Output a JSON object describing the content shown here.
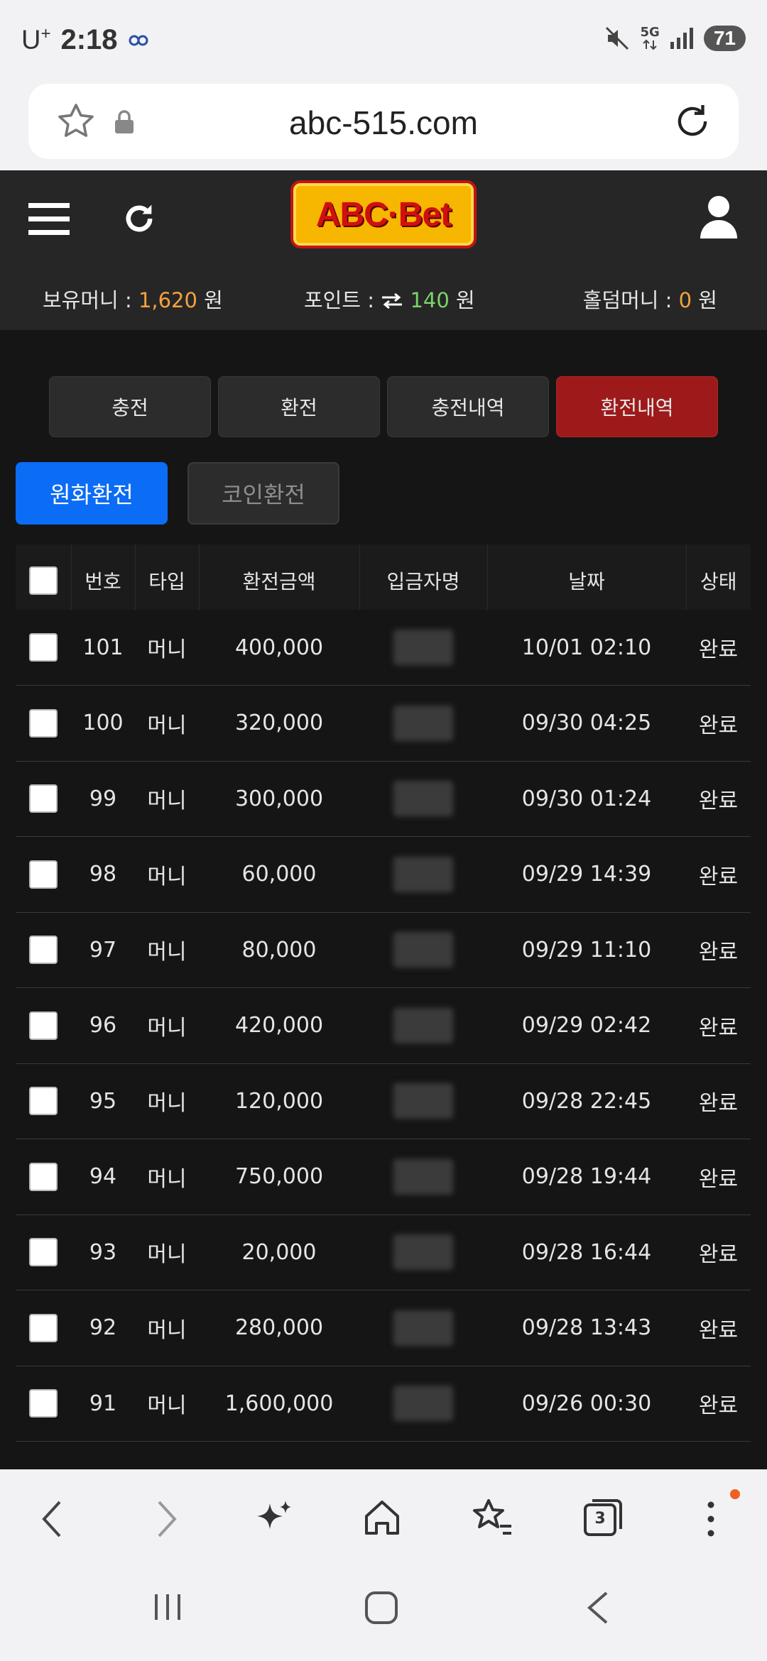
{
  "status_bar": {
    "carrier": "U",
    "carrier_sup": "+",
    "time": "2:18",
    "network": "5G",
    "battery": "71"
  },
  "browser": {
    "url": "abc-515.com",
    "tab_count": "3"
  },
  "site": {
    "logo_text": "ABC·Bet",
    "balances": {
      "money_label": "보유머니 : ",
      "money_value": "1,620",
      "money_unit": " 원",
      "point_label": "포인트 : ",
      "point_value": "140",
      "point_unit": " 원",
      "holdem_label": "홀덤머니 : ",
      "holdem_value": "0",
      "holdem_unit": " 원"
    },
    "tabs": [
      "충전",
      "환전",
      "충전내역",
      "환전내역"
    ],
    "active_tab": "환전내역",
    "subtabs": [
      "원화환전",
      "코인환전"
    ],
    "table": {
      "headers": [
        "",
        "번호",
        "타입",
        "환전금액",
        "입금자명",
        "날짜",
        "상태"
      ],
      "rows": [
        {
          "no": "101",
          "type": "머니",
          "amount": "400,000",
          "date": "10/01 02:10",
          "status": "완료"
        },
        {
          "no": "100",
          "type": "머니",
          "amount": "320,000",
          "date": "09/30 04:25",
          "status": "완료"
        },
        {
          "no": "99",
          "type": "머니",
          "amount": "300,000",
          "date": "09/30 01:24",
          "status": "완료"
        },
        {
          "no": "98",
          "type": "머니",
          "amount": "60,000",
          "date": "09/29 14:39",
          "status": "완료"
        },
        {
          "no": "97",
          "type": "머니",
          "amount": "80,000",
          "date": "09/29 11:10",
          "status": "완료"
        },
        {
          "no": "96",
          "type": "머니",
          "amount": "420,000",
          "date": "09/29 02:42",
          "status": "완료"
        },
        {
          "no": "95",
          "type": "머니",
          "amount": "120,000",
          "date": "09/28 22:45",
          "status": "완료"
        },
        {
          "no": "94",
          "type": "머니",
          "amount": "750,000",
          "date": "09/28 19:44",
          "status": "완료"
        },
        {
          "no": "93",
          "type": "머니",
          "amount": "20,000",
          "date": "09/28 16:44",
          "status": "완료"
        },
        {
          "no": "92",
          "type": "머니",
          "amount": "280,000",
          "date": "09/28 13:43",
          "status": "완료"
        },
        {
          "no": "91",
          "type": "머니",
          "amount": "1,600,000",
          "date": "09/26 00:30",
          "status": "완료"
        }
      ]
    }
  },
  "icons": {
    "header_left": [
      "menu-icon",
      "refresh-icon"
    ],
    "header_right": "user-icon",
    "browser_nav": [
      "back-icon",
      "forward-icon",
      "sparkle-icon",
      "home-icon",
      "bookmark-icon",
      "tabs-icon",
      "more-icon"
    ],
    "system_nav": [
      "recents-icon",
      "home-button-icon",
      "system-back-icon"
    ]
  },
  "colors": {
    "accent_blue": "#0b6cf5",
    "active_tab_red": "#9e1a1a",
    "money_orange": "#f4a23c",
    "point_green": "#7bd36a",
    "logo_yellow": "#f7b600"
  }
}
